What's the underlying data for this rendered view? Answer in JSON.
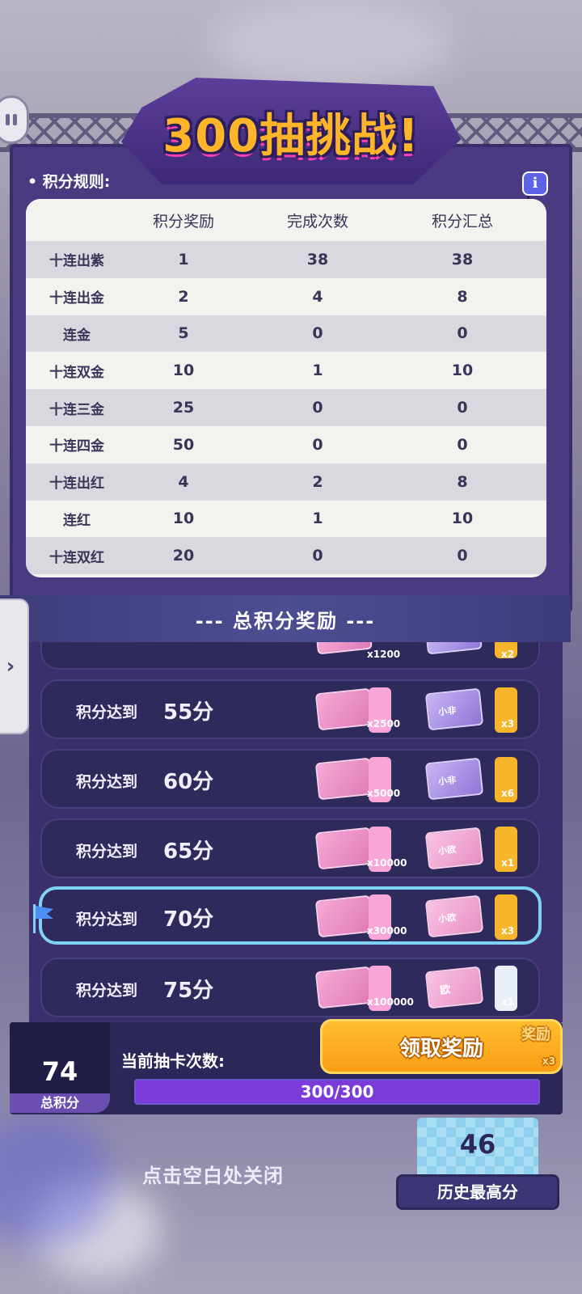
{
  "title": "300抽挑战!",
  "rules_label": "• 积分规则:",
  "table": {
    "headers": [
      "",
      "积分奖励",
      "完成次数",
      "积分汇总"
    ],
    "rows": [
      {
        "name": "十连出紫",
        "reward": "1",
        "count": "38",
        "total": "38"
      },
      {
        "name": "十连出金",
        "reward": "2",
        "count": "4",
        "total": "8"
      },
      {
        "name": "连金",
        "reward": "5",
        "count": "0",
        "total": "0"
      },
      {
        "name": "十连双金",
        "reward": "10",
        "count": "1",
        "total": "10"
      },
      {
        "name": "十连三金",
        "reward": "25",
        "count": "0",
        "total": "0"
      },
      {
        "name": "十连四金",
        "reward": "50",
        "count": "0",
        "total": "0"
      },
      {
        "name": "十连出红",
        "reward": "4",
        "count": "2",
        "total": "8"
      },
      {
        "name": "连红",
        "reward": "10",
        "count": "1",
        "total": "10"
      },
      {
        "name": "十连双红",
        "reward": "20",
        "count": "0",
        "total": "0"
      }
    ]
  },
  "reward_banner": "--- 总积分奖励 ---",
  "side_tab_icon": "chevron-right-icon",
  "tiers": [
    {
      "label": "积分达到",
      "score": "55分",
      "qty1": "x2500",
      "qty2": "x3",
      "item2": "小非"
    },
    {
      "label": "积分达到",
      "score": "60分",
      "qty1": "x5000",
      "qty2": "x6",
      "item2": "小非"
    },
    {
      "label": "积分达到",
      "score": "65分",
      "qty1": "x10000",
      "qty2": "x1",
      "item2": "小欧"
    },
    {
      "label": "积分达到",
      "score": "70分",
      "qty1": "x30000",
      "qty2": "x3",
      "item2": "小欧"
    },
    {
      "label": "积分达到",
      "score": "75分",
      "qty1": "x100000",
      "qty2": "x1",
      "item2": "欧"
    }
  ],
  "partial_tier": {
    "qty1": "x1200",
    "qty2": "x2"
  },
  "total_score": {
    "value": "74",
    "label": "总积分"
  },
  "draw_count_label": "当前抽卡次数:",
  "claim_button": "领取奖励",
  "claim_overlay_text": "奖励",
  "claim_overlay_qty": "x3",
  "progress": {
    "text": "300/300",
    "fraction": 1.0
  },
  "close_hint": "点击空白处关闭",
  "high_score": {
    "value": "46",
    "label": "历史最高分"
  },
  "colors": {
    "accent_orange": "#ffb52a",
    "panel_purple": "#4a3a82",
    "current_tier_border": "#7fd2f5"
  }
}
